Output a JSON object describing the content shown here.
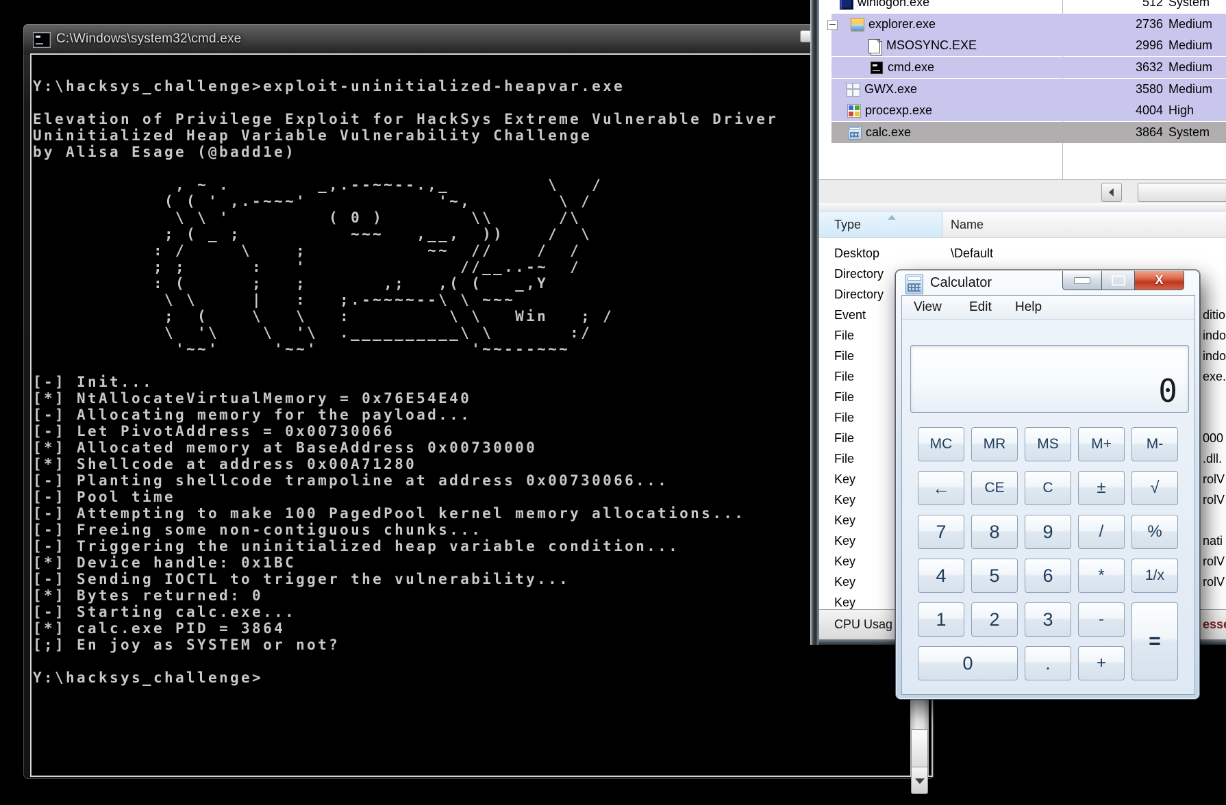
{
  "cmd_window": {
    "title": "C:\\Windows\\system32\\cmd.exe",
    "terminal_lines": [
      "Y:\\hacksys_challenge>exploit-uninitialized-heapvar.exe",
      "",
      "Elevation of Privilege Exploit for HackSys Extreme Vulnerable Driver",
      "Uninitialized Heap Variable Vulnerability Challenge",
      "by Alisa Esage (@badd1e)",
      "",
      "             , ~ .        _,.--~~--.,_         \\   /",
      "            ( ( ' ,.-~~~'            '~,        \\ /",
      "             \\ \\ '         ( 0 )        \\\\      /\\",
      "            ; ( _ ;          ~~~   ,__,  ))    /  \\",
      "           : /     \\    ;           ~~  //    /  /",
      "           ; ;      :   '              //__..-~  /",
      "           : (      ;   ;       ,;   ,( (   _,Y",
      "            \\ \\     |   :   ;.-~~~~--\\ \\ ~~~",
      "            ;  (    \\   \\   :         \\ \\   Win   ; /",
      "            \\  '\\    \\  '\\  .__________\\ \\       :/",
      "             '~~'     '~~'              '~~---~~~",
      "",
      "[-] Init...",
      "[*] NtAllocateVirtualMemory = 0x76E54E40",
      "[-] Allocating memory for the payload...",
      "[-] Let PivotAddress = 0x00730066",
      "[*] Allocated memory at BaseAddress 0x00730000",
      "[*] Shellcode at address 0x00A71280",
      "[-] Planting shellcode trampoline at address 0x00730066...",
      "[-] Pool time",
      "[-] Attempting to make 100 PagedPool kernel memory allocations...",
      "[-] Freeing some non-contiguous chunks...",
      "[-] Triggering the uninitialized heap variable condition...",
      "[*] Device handle: 0x1BC",
      "[-] Sending IOCTL to trigger the vulnerability...",
      "[*] Bytes returned: 0",
      "[-] Starting calc.exe...",
      "[*] calc.exe PID = 3864",
      "[;] En joy as SYSTEM or not?",
      "",
      "Y:\\hacksys_challenge>"
    ]
  },
  "process_explorer": {
    "tree_rows": [
      {
        "name": "winlogon.exe",
        "pid": "512",
        "priority": "System",
        "icon": "winlogon-icon",
        "highlight": "none",
        "expander": ""
      },
      {
        "name": "explorer.exe",
        "pid": "2736",
        "priority": "Medium",
        "icon": "folder-icon",
        "highlight": "lavender",
        "expander": "-"
      },
      {
        "name": "MSOSYNC.EXE",
        "pid": "2996",
        "priority": "Medium",
        "icon": "document-icon",
        "highlight": "lavender",
        "expander": ""
      },
      {
        "name": "cmd.exe",
        "pid": "3632",
        "priority": "Medium",
        "icon": "console-icon",
        "highlight": "lavender",
        "expander": ""
      },
      {
        "name": "GWX.exe",
        "pid": "3580",
        "priority": "Medium",
        "icon": "window-grid-icon",
        "highlight": "lavender",
        "expander": ""
      },
      {
        "name": "procexp.exe",
        "pid": "4004",
        "priority": "High",
        "icon": "procexp-icon",
        "highlight": "lavender",
        "expander": ""
      },
      {
        "name": "calc.exe",
        "pid": "3864",
        "priority": "System",
        "icon": "calculator-icon",
        "highlight": "gray",
        "expander": ""
      }
    ],
    "lower_pane": {
      "columns": [
        "Type",
        "Name"
      ],
      "rows": [
        {
          "type": "Desktop",
          "name": "\\Default",
          "clipped": false
        },
        {
          "type": "Directory",
          "name": "",
          "clipped": true
        },
        {
          "type": "Directory",
          "name": "",
          "clipped": true
        },
        {
          "type": "Event",
          "name": "ditio",
          "clipped": true
        },
        {
          "type": "File",
          "name": "indo",
          "clipped": true
        },
        {
          "type": "File",
          "name": "indo",
          "clipped": true
        },
        {
          "type": "File",
          "name": "exe.",
          "clipped": true
        },
        {
          "type": "File",
          "name": "",
          "clipped": true
        },
        {
          "type": "File",
          "name": "",
          "clipped": true
        },
        {
          "type": "File",
          "name": "000",
          "clipped": true
        },
        {
          "type": "File",
          "name": ".dll.",
          "clipped": true
        },
        {
          "type": "Key",
          "name": "rolV",
          "clipped": true
        },
        {
          "type": "Key",
          "name": "rolV",
          "clipped": true
        },
        {
          "type": "Key",
          "name": "",
          "clipped": true
        },
        {
          "type": "Key",
          "name": "nati",
          "clipped": true
        },
        {
          "type": "Key",
          "name": "rolV",
          "clipped": true
        },
        {
          "type": "Key",
          "name": "rolV",
          "clipped": true
        },
        {
          "type": "Key",
          "name": "",
          "clipped": true
        }
      ],
      "status_left": "CPU Usag",
      "status_right": "esse"
    }
  },
  "calculator": {
    "title": "Calculator",
    "menu": [
      "View",
      "Edit",
      "Help"
    ],
    "display_value": "0",
    "keypad": [
      [
        "MC",
        "MR",
        "MS",
        "M+",
        "M-"
      ],
      [
        "←",
        "CE",
        "C",
        "±",
        "√"
      ],
      [
        "7",
        "8",
        "9",
        "/",
        "%"
      ],
      [
        "4",
        "5",
        "6",
        "*",
        "1/x"
      ],
      [
        "1",
        "2",
        "3",
        "-",
        "="
      ],
      [
        "0",
        ".",
        "+"
      ]
    ],
    "caption_buttons": {
      "close": "X"
    }
  },
  "colors": {
    "selection_lavender": "#c9c6ee",
    "selection_gray": "#b0aeae",
    "close_button_red": "#c0351f",
    "terminal_text": "#c8c8c8"
  }
}
